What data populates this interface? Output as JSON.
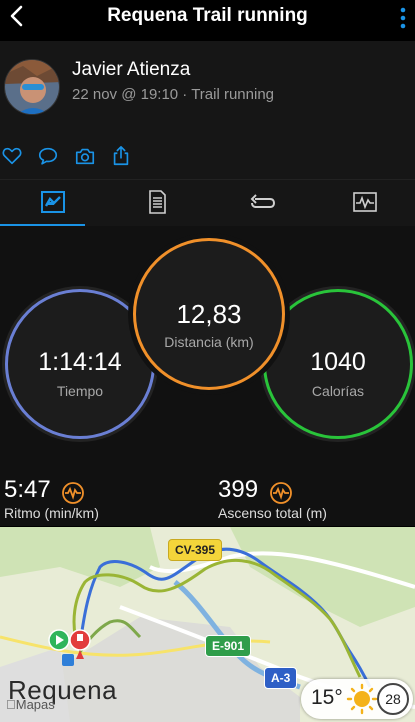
{
  "header": {
    "title": "Requena Trail running"
  },
  "activity": {
    "user_name": "Javier Atienza",
    "meta": "22 nov @ 19:10 · Trail running"
  },
  "stats": {
    "distance": {
      "value": "12,83",
      "label": "Distancia (km)"
    },
    "time": {
      "value": "1:14:14",
      "label": "Tiempo"
    },
    "calories": {
      "value": "1040",
      "label": "Calorías"
    },
    "pace": {
      "value": "5:47",
      "label": "Ritmo (min/km)"
    },
    "ascent": {
      "value": "399",
      "label": "Ascenso total (m)"
    }
  },
  "map": {
    "roads": [
      "CV-395",
      "E-901",
      "A-3"
    ],
    "city": "Requena",
    "attribution": "Mapas",
    "weather": {
      "temperature": "15°",
      "aqi": "28"
    }
  },
  "colors": {
    "accent_blue": "#1a93e6",
    "distance_ring": "#f0902a",
    "time_ring": "#6a7fd4",
    "calories_ring": "#29c43a",
    "pulse_icon": "#f0902a"
  },
  "icons": [
    "back-arrow-icon",
    "more-options-icon",
    "heart-icon",
    "comment-icon",
    "camera-icon",
    "share-icon",
    "stats-tab-icon",
    "details-tab-icon",
    "laps-tab-icon",
    "charts-tab-icon",
    "pulse-icon",
    "sun-icon",
    "start-pin-icon",
    "finish-pin-icon"
  ]
}
